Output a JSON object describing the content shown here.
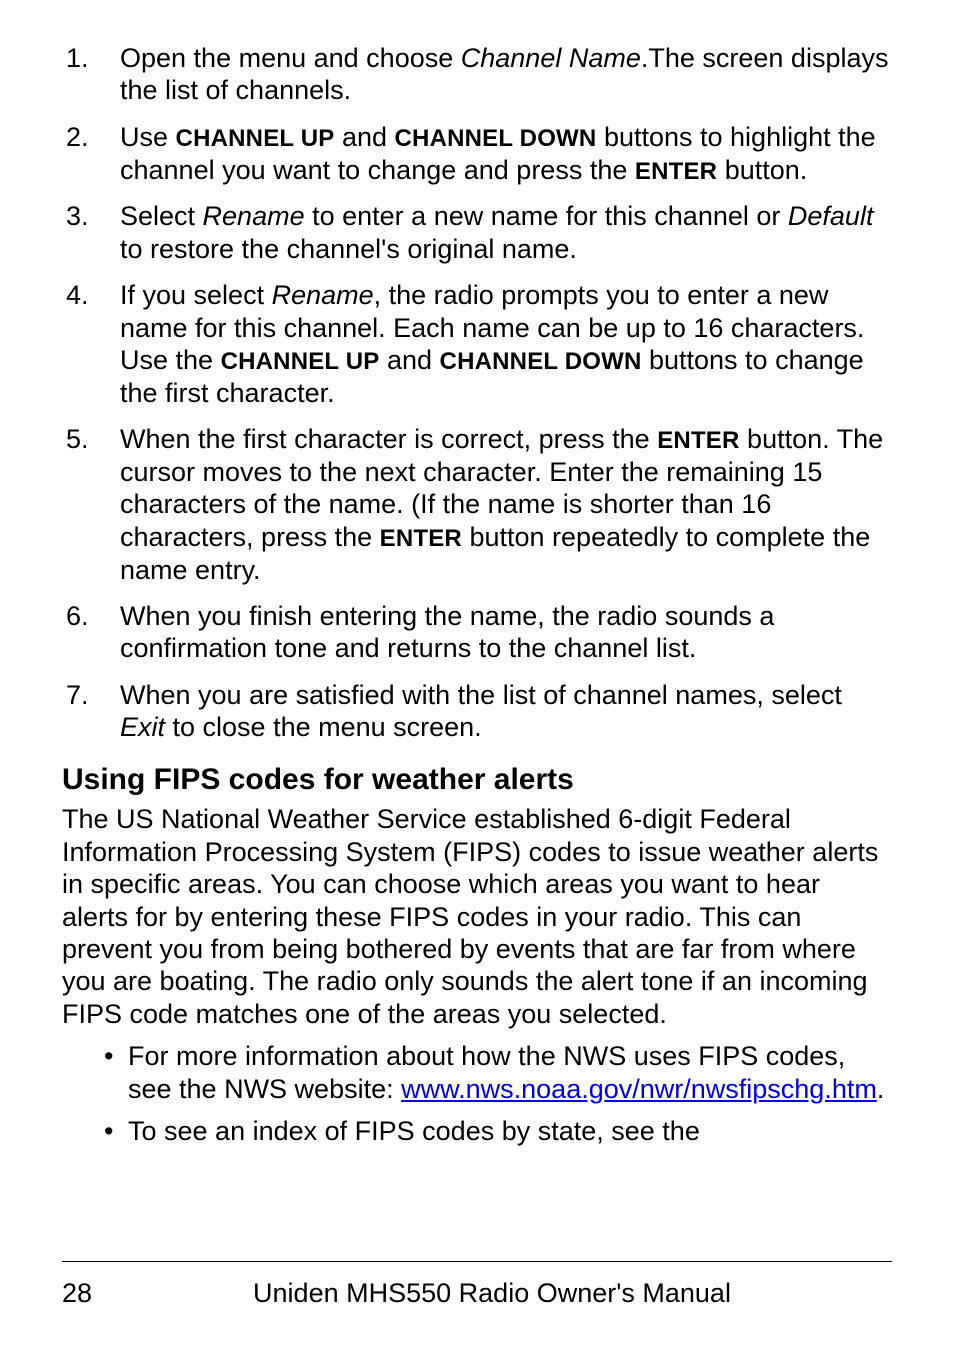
{
  "steps": [
    {
      "num": "1.",
      "parts": [
        {
          "t": "Open the menu and choose "
        },
        {
          "t": "Channel Name",
          "cls": "ital"
        },
        {
          "t": ".The screen displays the list of channels."
        }
      ]
    },
    {
      "num": "2.",
      "parts": [
        {
          "t": "Use "
        },
        {
          "t": "CHANNEL UP",
          "cls": "sc"
        },
        {
          "t": " and "
        },
        {
          "t": "CHANNEL DOWN",
          "cls": "sc"
        },
        {
          "t": " buttons to highlight the channel you want to change and press the "
        },
        {
          "t": "ENTER",
          "cls": "sc"
        },
        {
          "t": " button."
        }
      ]
    },
    {
      "num": "3.",
      "parts": [
        {
          "t": "Select "
        },
        {
          "t": "Rename",
          "cls": "ital"
        },
        {
          "t": " to enter a new name for this channel or "
        },
        {
          "t": "Default",
          "cls": "ital"
        },
        {
          "t": " to restore the channel's original name."
        }
      ]
    },
    {
      "num": "4.",
      "parts": [
        {
          "t": "If you select "
        },
        {
          "t": "Rename",
          "cls": "ital"
        },
        {
          "t": ", the radio prompts you to enter a new name for this channel. Each name can be up to 16 characters. Use the "
        },
        {
          "t": "CHANNEL UP",
          "cls": "sc"
        },
        {
          "t": " and "
        },
        {
          "t": "CHANNEL DOWN",
          "cls": "sc"
        },
        {
          "t": " buttons to change the first character."
        }
      ]
    },
    {
      "num": "5.",
      "parts": [
        {
          "t": "When the first character is correct, press the "
        },
        {
          "t": "ENTER",
          "cls": "sc"
        },
        {
          "t": " button. The cursor moves to the next character. Enter the remaining 15 characters of the name. (If the name is shorter than 16 characters, press the "
        },
        {
          "t": "ENTER",
          "cls": "sc"
        },
        {
          "t": " button repeatedly to complete the name entry."
        }
      ]
    },
    {
      "num": "6.",
      "parts": [
        {
          "t": "When you finish entering the name, the radio sounds a confirmation tone and returns to the channel list."
        }
      ]
    },
    {
      "num": "7.",
      "parts": [
        {
          "t": "When you are satisfied with the list of channel names, select "
        },
        {
          "t": "Exit",
          "cls": "ital"
        },
        {
          "t": " to close the menu screen."
        }
      ]
    }
  ],
  "heading": "Using FIPS codes for weather alerts",
  "paragraph": "The US National Weather Service established 6-digit Federal Information Processing System (FIPS) codes to issue weather alerts in specific areas. You can choose which areas you want to hear alerts for by entering these FIPS codes in your radio. This can prevent you from being bothered by events that are far from where you are boating. The radio only sounds the alert tone if an incoming FIPS code matches one of the areas you selected.",
  "bullets": [
    {
      "parts": [
        {
          "t": "For more information about how the NWS uses FIPS codes, see the NWS website: "
        },
        {
          "t": "www.nws.noaa.gov/nwr/nwsfipschg.htm",
          "cls": "link"
        },
        {
          "t": "."
        }
      ]
    },
    {
      "parts": [
        {
          "t": "To see an index of FIPS codes by state, see the"
        }
      ]
    }
  ],
  "footer": {
    "page": "28",
    "title": "Uniden MHS550 Radio Owner's Manual"
  }
}
